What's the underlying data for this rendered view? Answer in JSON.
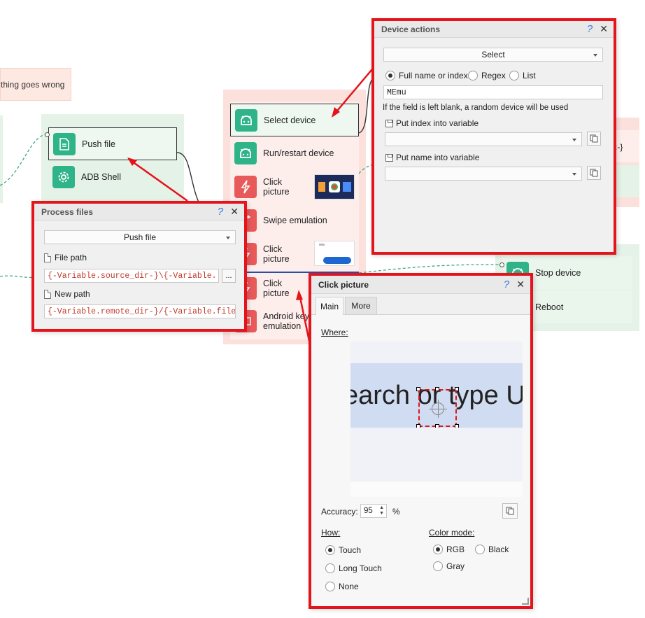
{
  "canvas": {
    "error_note": "thing goes wrong",
    "partial_curly": ":-}",
    "left_group": {
      "nodes": [
        {
          "label": "Push file",
          "icon": "document-icon"
        },
        {
          "label": "ADB Shell",
          "icon": "gear-icon"
        }
      ]
    },
    "mid_group": {
      "nodes": [
        {
          "label": "Select device",
          "icon": "android-icon"
        },
        {
          "label": "Run/restart device",
          "icon": "android-icon"
        },
        {
          "label": "Click picture",
          "icon": "lightning-icon"
        },
        {
          "label": "Swipe emulation",
          "icon": "swipe-icon"
        },
        {
          "label": "Click picture",
          "icon": "lightning-icon"
        },
        {
          "label": "Click picture",
          "icon": "lightning-icon"
        },
        {
          "label": "Android key emulation",
          "icon": "keyboard-icon"
        }
      ]
    },
    "right_group": {
      "nodes": [
        {
          "label": "Stop device",
          "icon": "android-icon"
        },
        {
          "label": "Reboot",
          "icon": "android-icon"
        }
      ]
    }
  },
  "process_files": {
    "title": "Process files",
    "help": "?",
    "close": "✕",
    "action": "Push file",
    "file_path_label": "File path",
    "file_path_value": "{-Variable.source_dir-}\\{-Variable.",
    "browse": "...",
    "new_path_label": "New path",
    "new_path_value": "{-Variable.remote_dir-}/{-Variable.file"
  },
  "device_actions": {
    "title": "Device actions",
    "help": "?",
    "close": "✕",
    "action": "Select",
    "radio_fullname": "Full name or index:",
    "radio_regex": "Regex",
    "radio_list": "List",
    "device_value": "MEmu",
    "hint": "If the field is left blank, a random device will be used",
    "index_label": "Put index into variable",
    "name_label": "Put name into variable"
  },
  "click_picture": {
    "title": "Click picture",
    "help": "?",
    "close": "✕",
    "tabs": [
      "Main",
      "More"
    ],
    "where_label": "Where:",
    "preview_text": "earch or type U",
    "accuracy_label": "Accuracy:",
    "accuracy_value": "95",
    "accuracy_unit": "%",
    "how_label": "How:",
    "how_options": [
      "Touch",
      "Long Touch",
      "None"
    ],
    "how_selected": "Touch",
    "color_label": "Color mode:",
    "color_options": [
      "RGB",
      "Black",
      "Gray"
    ],
    "color_selected": "RGB"
  },
  "colors": {
    "highlight_red": "#e3141b",
    "node_green": "#2fb489",
    "node_red": "#e85a5a",
    "group_green": "#e4f2e7",
    "group_red": "#fbe0dc"
  }
}
